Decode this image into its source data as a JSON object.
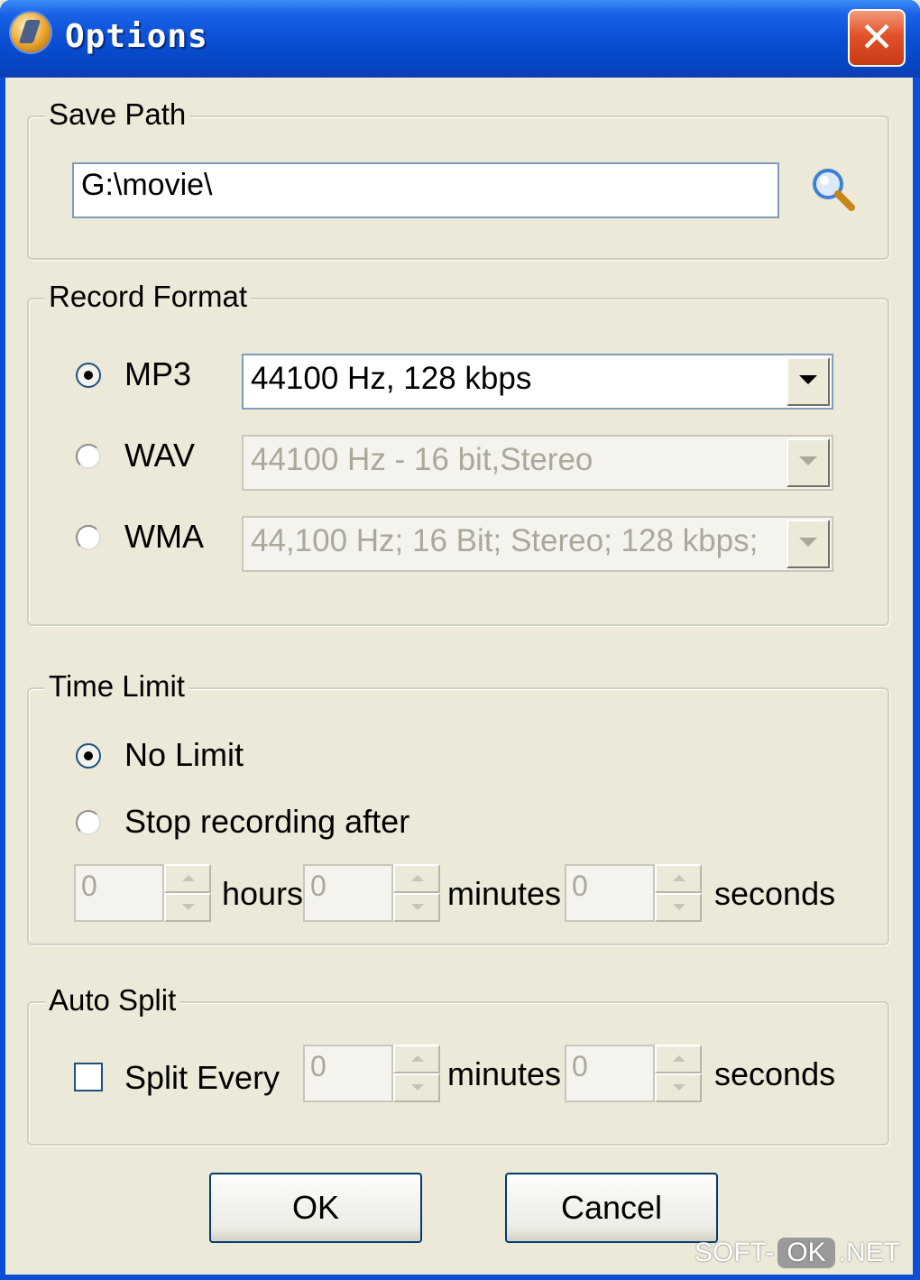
{
  "window": {
    "title": "Options",
    "close_label": "✕"
  },
  "save_path": {
    "legend": "Save Path",
    "value": "G:\\movie\\"
  },
  "record_format": {
    "legend": "Record Format",
    "options": [
      {
        "label": "MP3",
        "value": "44100 Hz, 128 kbps",
        "selected": true
      },
      {
        "label": "WAV",
        "value": "44100 Hz - 16 bit,Stereo",
        "selected": false
      },
      {
        "label": "WMA",
        "value": "44,100 Hz; 16 Bit; Stereo; 128 kbps;",
        "selected": false
      }
    ]
  },
  "time_limit": {
    "legend": "Time Limit",
    "no_limit_label": "No Limit",
    "stop_after_label": "Stop recording after",
    "hours_value": "0",
    "hours_label": "hours",
    "minutes_value": "0",
    "minutes_label": "minutes",
    "seconds_value": "0",
    "seconds_label": "seconds"
  },
  "auto_split": {
    "legend": "Auto Split",
    "split_every_label": "Split Every",
    "minutes_value": "0",
    "minutes_label": "minutes",
    "seconds_value": "0",
    "seconds_label": "seconds"
  },
  "buttons": {
    "ok": "OK",
    "cancel": "Cancel"
  },
  "watermark": {
    "left": "SOFT-",
    "mid": "OK",
    "right": ".NET"
  }
}
